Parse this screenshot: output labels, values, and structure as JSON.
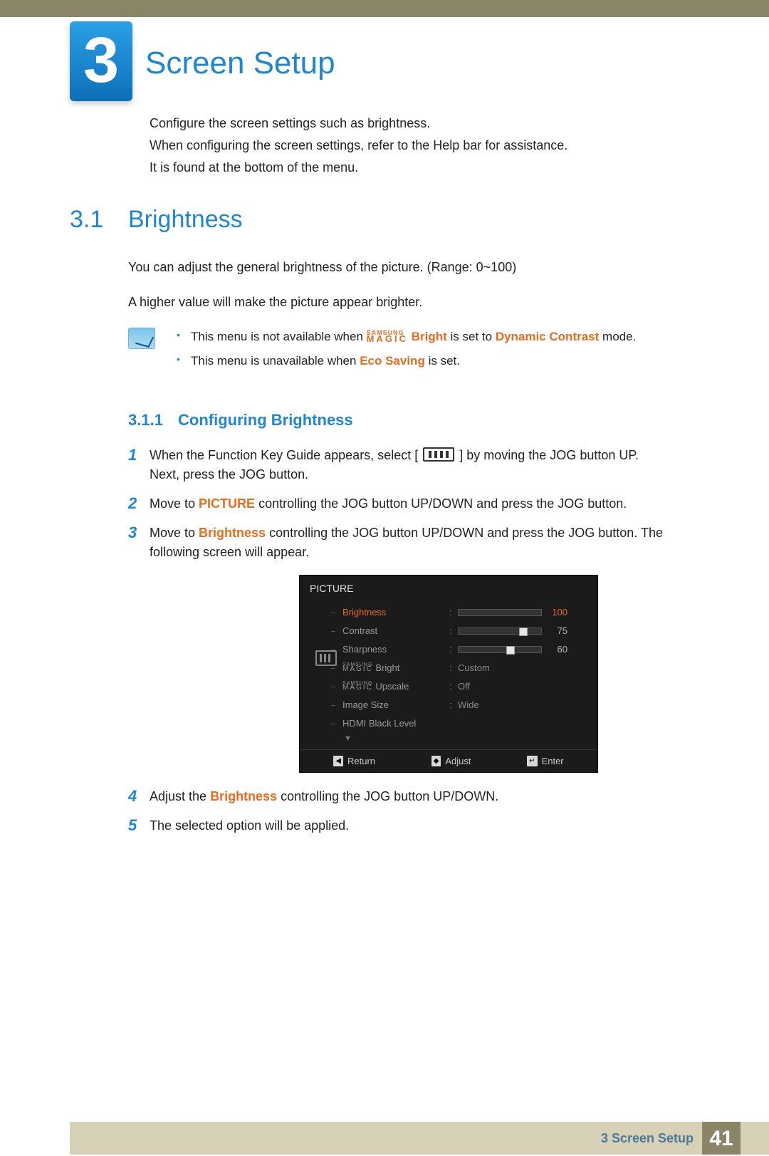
{
  "chapter": {
    "number": "3",
    "title": "Screen Setup"
  },
  "intro": {
    "l1": "Configure the screen settings such as brightness.",
    "l2": "When configuring the screen settings, refer to the Help bar for assistance.",
    "l3": "It is found at the bottom of the menu."
  },
  "section": {
    "num": "3.1",
    "title": "Brightness"
  },
  "body": {
    "p1": "You can adjust the general brightness of the picture. (Range: 0~100)",
    "p2": "A higher value will make the picture appear brighter."
  },
  "notes": {
    "n1_a": "This menu is not available when ",
    "n1_bright": "Bright",
    "n1_b": " is set to ",
    "n1_dc": "Dynamic Contrast",
    "n1_c": " mode.",
    "n2_a": "This menu is unavailable when ",
    "n2_eco": "Eco Saving",
    "n2_b": " is set."
  },
  "subsection": {
    "num": "3.1.1",
    "title": "Configuring Brightness"
  },
  "steps": {
    "s1a": "When the Function Key Guide appears, select ",
    "s1b": " by moving the JOG button UP. Next, press the JOG button.",
    "s2a": "Move to ",
    "s2_pic": "PICTURE",
    "s2b": " controlling the JOG button UP/DOWN and press the JOG button.",
    "s3a": "Move to ",
    "s3_b": "Brightness",
    "s3b": " controlling the JOG button UP/DOWN and press the JOG button. The following screen will appear.",
    "s4a": "Adjust the ",
    "s4_b": "Brightness",
    "s4b": " controlling the JOG button UP/DOWN.",
    "s5": "The selected option will be applied."
  },
  "osd": {
    "title": "PICTURE",
    "rows": {
      "brightness": {
        "label": "Brightness",
        "value": 100
      },
      "contrast": {
        "label": "Contrast",
        "value": 75
      },
      "sharpness": {
        "label": "Sharpness",
        "value": 60
      },
      "magic_bright": {
        "suffix": "Bright",
        "value": "Custom"
      },
      "magic_upscale": {
        "suffix": "Upscale",
        "value": "Off"
      },
      "image_size": {
        "label": "Image Size",
        "value": "Wide"
      },
      "hdmi_black": {
        "label": "HDMI Black Level"
      }
    },
    "footer": {
      "return": "Return",
      "adjust": "Adjust",
      "enter": "Enter"
    }
  },
  "footer": {
    "text": "3 Screen Setup",
    "page": "41"
  },
  "magic": {
    "samsung": "SAMSUNG",
    "magic": "MAGIC"
  }
}
